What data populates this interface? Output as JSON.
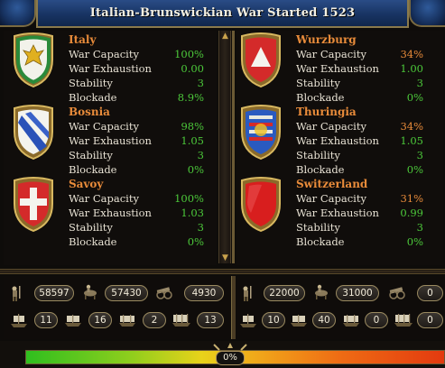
{
  "title": "Italian-Brunswickian War Started 1523",
  "labels": {
    "war_capacity": "War Capacity",
    "war_exhaustion": "War Exhaustion",
    "stability": "Stability",
    "blockade": "Blockade"
  },
  "attackers": [
    {
      "name": "Italy",
      "war_capacity": "100%",
      "war_exhaustion": "0.00",
      "stability": "3",
      "blockade": "8.9%"
    },
    {
      "name": "Bosnia",
      "war_capacity": "98%",
      "war_exhaustion": "1.05",
      "stability": "3",
      "blockade": "0%"
    },
    {
      "name": "Savoy",
      "war_capacity": "100%",
      "war_exhaustion": "1.03",
      "stability": "3",
      "blockade": "0%"
    }
  ],
  "defenders": [
    {
      "name": "Wurzburg",
      "war_capacity": "34%",
      "war_exhaustion": "1.00",
      "stability": "3",
      "blockade": "0%"
    },
    {
      "name": "Thuringia",
      "war_capacity": "34%",
      "war_exhaustion": "1.05",
      "stability": "3",
      "blockade": "0%"
    },
    {
      "name": "Switzerland",
      "war_capacity": "31%",
      "war_exhaustion": "0.99",
      "stability": "3",
      "blockade": "0%"
    }
  ],
  "attacker_forces": {
    "infantry": "58597",
    "cavalry": "57430",
    "artillery": "4930",
    "big_ships": "11",
    "galleys": "16",
    "transports": "2",
    "light_ships": "13"
  },
  "defender_forces": {
    "infantry": "22000",
    "cavalry": "31000",
    "artillery": "0",
    "big_ships": "10",
    "galleys": "40",
    "transports": "0",
    "light_ships": "0"
  },
  "war_score": "0%",
  "colors": {
    "country_name": "#e88b3a",
    "good_value": "#4cc83a",
    "bad_value": "#e88b3a",
    "title_bg": "#183463"
  }
}
